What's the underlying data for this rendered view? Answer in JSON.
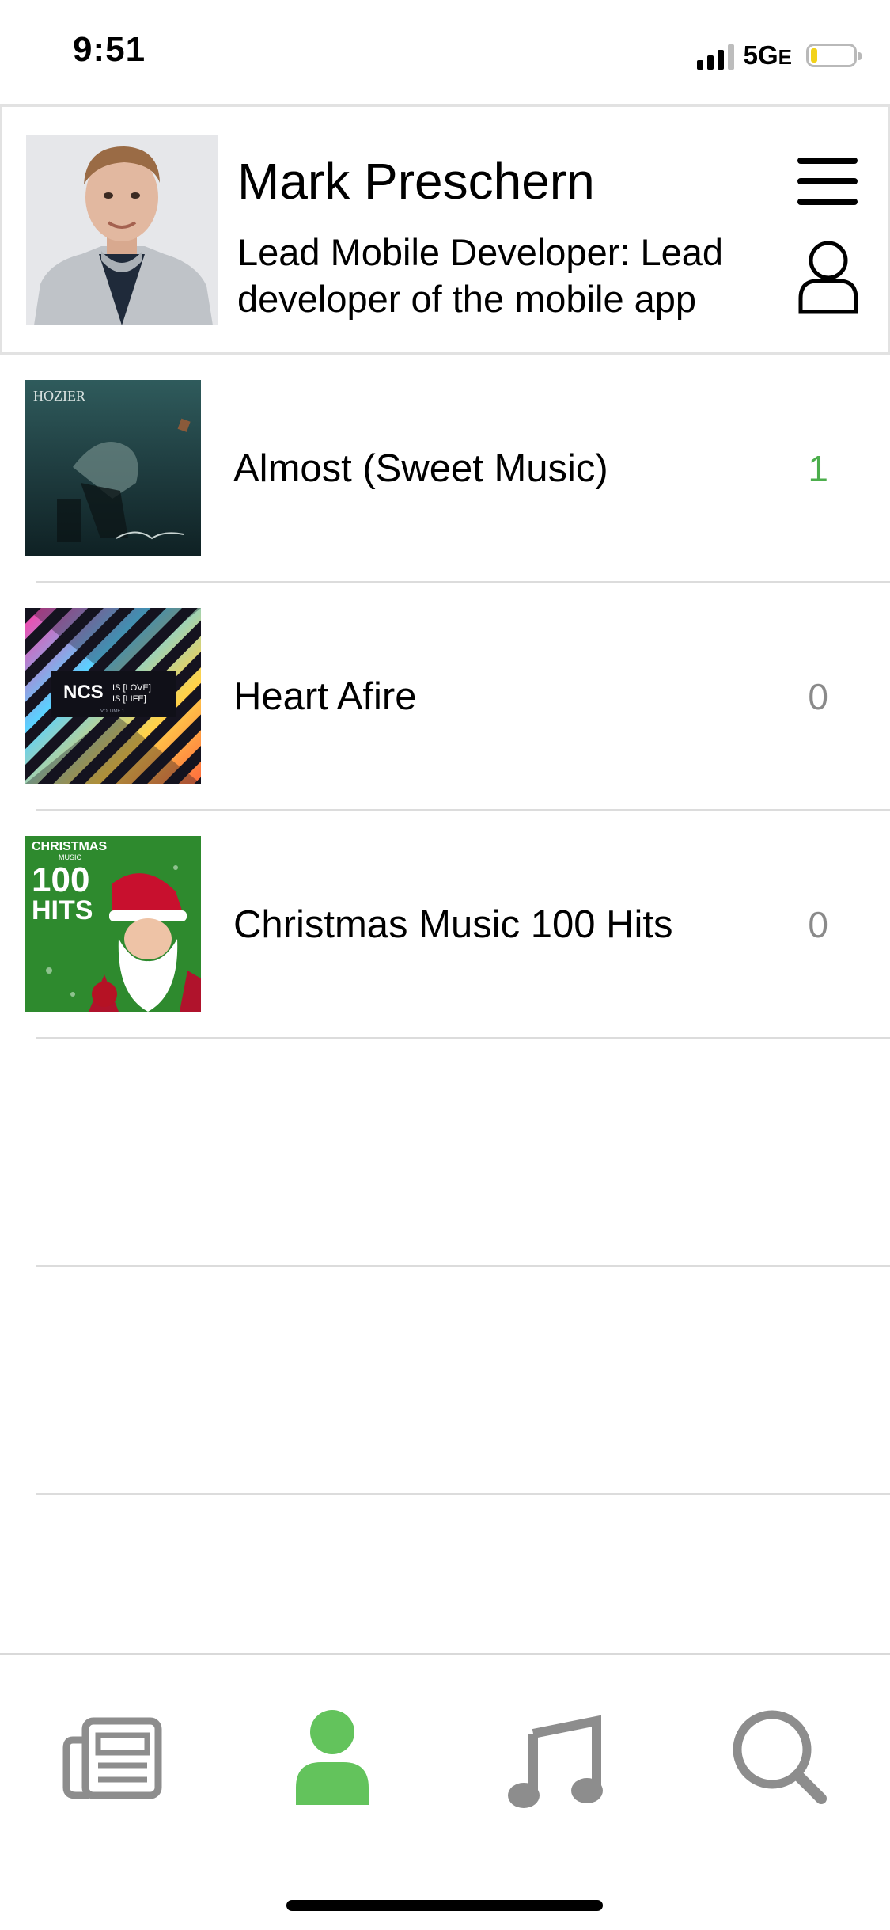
{
  "status_bar": {
    "time": "9:51",
    "network": "5G",
    "network_suffix": "E"
  },
  "profile": {
    "name": "Mark Preschern",
    "role": "Lead Mobile Developer: Lead developer of the mobile app",
    "avatar_icon": "profile-photo",
    "menu_icon": "hamburger-menu-icon",
    "account_icon": "person-outline-icon"
  },
  "songs": [
    {
      "title": "Almost (Sweet Music)",
      "count": "1",
      "artwork": "hozier-album-art"
    },
    {
      "title": "Heart Afire",
      "count": "0",
      "artwork": "ncs-album-art"
    },
    {
      "title": "Christmas Music 100 Hits",
      "count": "0",
      "artwork": "christmas-album-art"
    }
  ],
  "artwork_text": {
    "hozier": "HOZIER",
    "ncs_logo": "NCS",
    "ncs_line1": "IS [LOVE]",
    "ncs_line2": "IS [LIFE]",
    "ncs_volume": "VOLUME 1",
    "xmas_top": "CHRISTMAS",
    "xmas_small": "MUSIC",
    "xmas_big": "100",
    "xmas_hits": "HITS"
  },
  "tab_bar": {
    "tabs": [
      {
        "name": "news",
        "icon": "newspaper-icon",
        "active": false
      },
      {
        "name": "profile",
        "icon": "person-icon",
        "active": true
      },
      {
        "name": "music",
        "icon": "music-note-icon",
        "active": false
      },
      {
        "name": "search",
        "icon": "search-icon",
        "active": false
      }
    ],
    "active_color": "#63c35c",
    "inactive_color": "#8d8d8d"
  },
  "colors": {
    "accent_green": "#4cae4c",
    "count_gray": "#8a8a8a",
    "divider": "#dcdcdc"
  }
}
